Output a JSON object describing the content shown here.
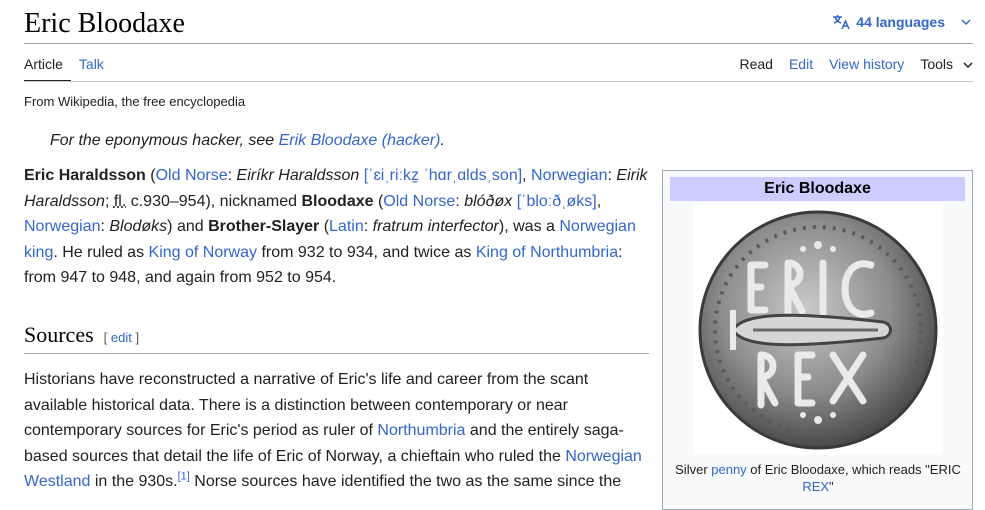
{
  "page": {
    "title": "Eric Bloodaxe",
    "languages": "44 languages",
    "tabs_left": [
      "Article",
      "Talk"
    ],
    "tabs_right": [
      "Read",
      "Edit",
      "View history",
      "Tools"
    ],
    "tagline": "From Wikipedia, the free encyclopedia",
    "hatnote_prefix": "For the eponymous hacker, see ",
    "hatnote_link": "Erik Bloodaxe (hacker)",
    "hatnote_suffix": "."
  },
  "intro": {
    "p1": "Eric Haraldsson",
    "p2": " (",
    "p3": "Old Norse",
    "p4": ": ",
    "p5": "Eiríkr Haraldsson",
    "p6": " ",
    "p7": "[ˈɛiˌriːkz̠ ˈhɑrˌɑldsˌson]",
    "p8": ", ",
    "p9": "Norwegian",
    "p10": ": ",
    "p11": "Eirik Haraldsson",
    "p12": "; ",
    "p13": "fl.",
    "p14": " c.930–954), nicknamed ",
    "p15": "Bloodaxe",
    "p16": " (",
    "p17": "Old Norse",
    "p18": ": ",
    "p19": "blóðøx",
    "p20": " ",
    "p21": "[ˈbloːðˌøks]",
    "p22": ", ",
    "p23": "Norwegian",
    "p24": ": ",
    "p25": "Blodøks",
    "p26": ") and ",
    "p27": "Brother-Slayer",
    "p28": " (",
    "p29": "Latin",
    "p30": ": ",
    "p31": "fratrum interfector",
    "p32": "), was a ",
    "p33": "Norwegian king",
    "p34": ". He ruled as ",
    "p35": "King of Norway",
    "p36": " from 932 to 934, and twice as ",
    "p37": "King of Northumbria",
    "p38": ": from 947 to 948, and again from 952 to 954."
  },
  "sources": {
    "heading": "Sources",
    "edit": "edit",
    "edit_open": "[ ",
    "edit_close": " ]",
    "s1": "Historians have reconstructed a narrative of Eric's life and career from the scant available historical data. There is a distinction between contemporary or near contemporary sources for Eric's period as ruler of ",
    "s2": "Northumbria",
    "s3": " and the entirely saga-based sources that detail the life of Eric of Norway, a chieftain who ruled the ",
    "s4": "Norwegian Westland",
    "s5": " in the 930s.",
    "s6": "[1]",
    "s7": " Norse sources have identified the two as the same since the"
  },
  "infobox": {
    "title": "Eric Bloodaxe",
    "cap1": "Silver ",
    "cap2": "penny",
    "cap3": " of Eric Bloodaxe, which reads \"ERIC ",
    "cap4": "REX",
    "cap5": "\""
  },
  "colors": {
    "link": "#3366cc",
    "infobox_header": "#ccccff",
    "infobox_bg": "#f8f9fa"
  }
}
